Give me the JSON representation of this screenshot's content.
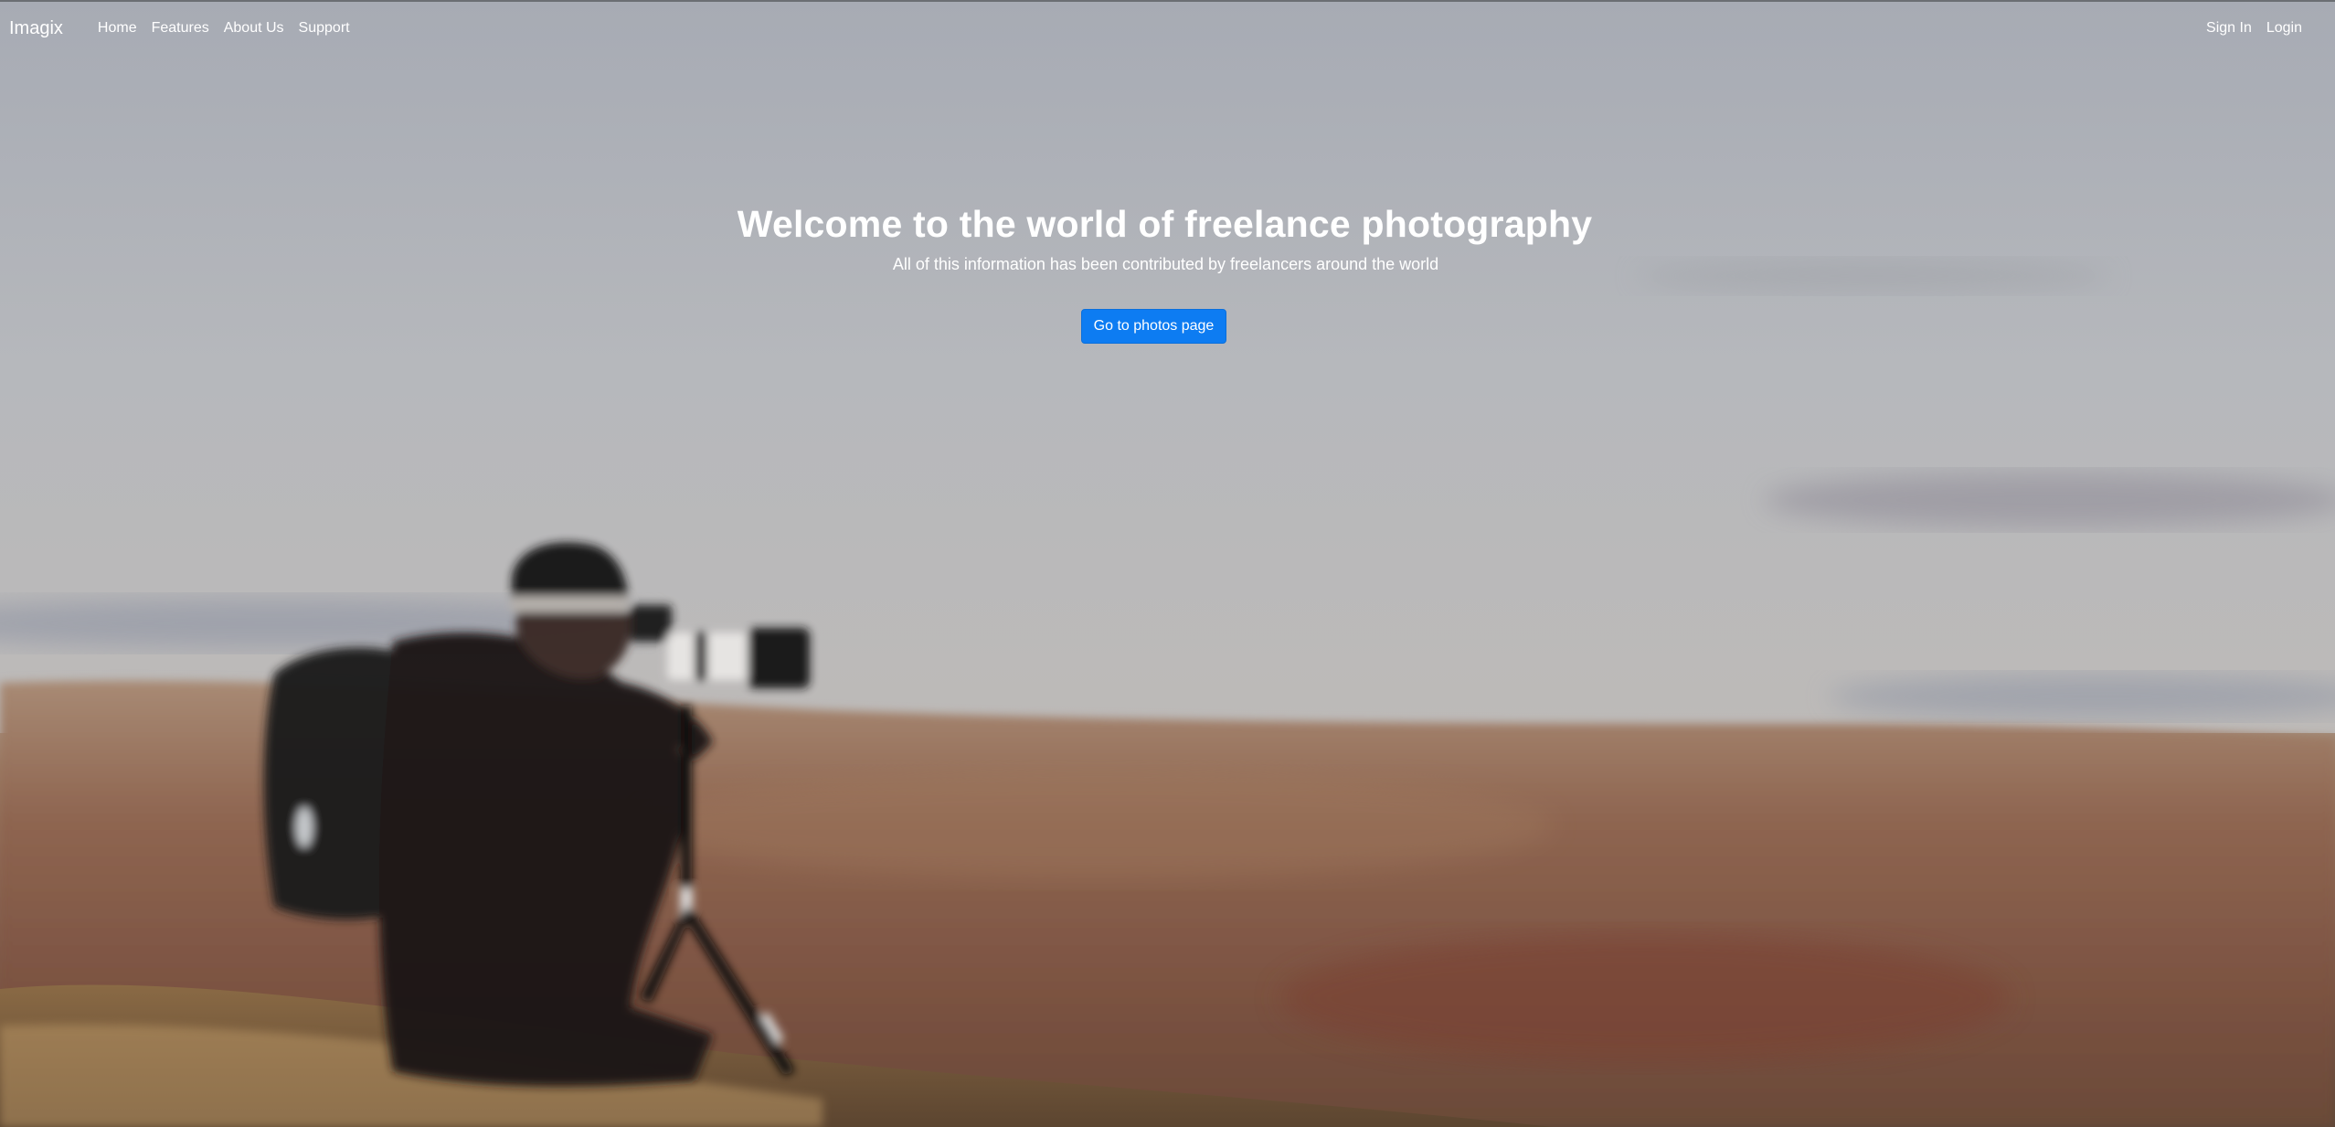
{
  "navbar": {
    "brand": "Imagix",
    "links": [
      {
        "label": "Home"
      },
      {
        "label": "Features"
      },
      {
        "label": "About Us"
      },
      {
        "label": "Support"
      }
    ],
    "right_links": [
      {
        "label": "Sign In"
      },
      {
        "label": "Login"
      }
    ]
  },
  "hero": {
    "title": "Welcome to the world of freelance photography",
    "subtitle": "All of this information has been contributed by freelancers around the world",
    "button_label": "Go to photos page",
    "button_color": "#0d7cf2"
  },
  "background": {
    "description_icon": "photographer-with-camera-on-tripod-image"
  }
}
